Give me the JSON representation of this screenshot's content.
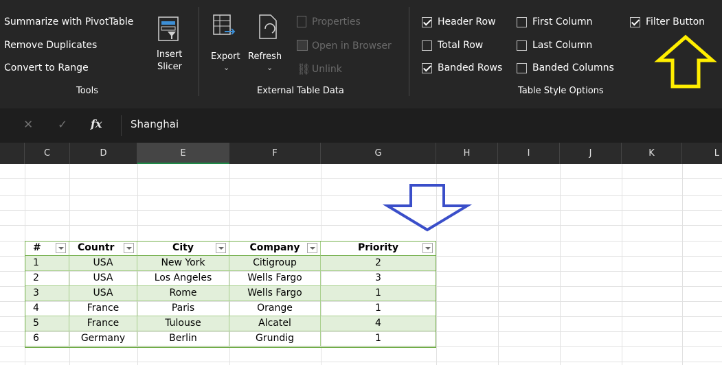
{
  "ribbon": {
    "tools": {
      "summarize": "Summarize with PivotTable",
      "remove_duplicates": "Remove Duplicates",
      "convert_range": "Convert to Range",
      "insert_slicer": [
        "Insert",
        "Slicer"
      ],
      "group_label": "Tools"
    },
    "external": {
      "export": "Export",
      "refresh": "Refresh",
      "properties": "Properties",
      "open_browser": "Open in Browser",
      "unlink": "Unlink",
      "group_label": "External Table Data"
    },
    "style_options": {
      "header_row": {
        "label": "Header Row",
        "checked": true
      },
      "total_row": {
        "label": "Total Row",
        "checked": false
      },
      "banded_rows": {
        "label": "Banded Rows",
        "checked": true
      },
      "first_column": {
        "label": "First Column",
        "checked": false
      },
      "last_column": {
        "label": "Last Column",
        "checked": false
      },
      "banded_columns": {
        "label": "Banded Columns",
        "checked": false
      },
      "filter_button": {
        "label": "Filter Button",
        "checked": true
      },
      "group_label": "Table Style Options"
    }
  },
  "formula_bar": {
    "cancel_icon": "close-icon",
    "enter_icon": "check-icon",
    "fx": "fx",
    "value": "Shanghai"
  },
  "columns": [
    "C",
    "D",
    "E",
    "F",
    "G",
    "H",
    "I",
    "J",
    "K",
    "L"
  ],
  "selected_column": "E",
  "table": {
    "headers": [
      "#",
      "Countr",
      "City",
      "Company",
      "Priority"
    ],
    "rows": [
      [
        "1",
        "USA",
        "New York",
        "Citigroup",
        "2"
      ],
      [
        "2",
        "USA",
        "Los Angeles",
        "Wells Fargo",
        "3"
      ],
      [
        "3",
        "USA",
        "Rome",
        "Wells Fargo",
        "1"
      ],
      [
        "4",
        "France",
        "Paris",
        "Orange",
        "1"
      ],
      [
        "5",
        "France",
        "Tulouse",
        "Alcatel",
        "4"
      ],
      [
        "6",
        "Germany",
        "Berlin",
        "Grundig",
        "1"
      ]
    ]
  },
  "colors": {
    "ribbon_bg": "#262626",
    "table_accent": "#70ad47",
    "band": "#e2efda",
    "yellow_arrow": "#ffee00",
    "blue_arrow": "#3a4ec9"
  }
}
